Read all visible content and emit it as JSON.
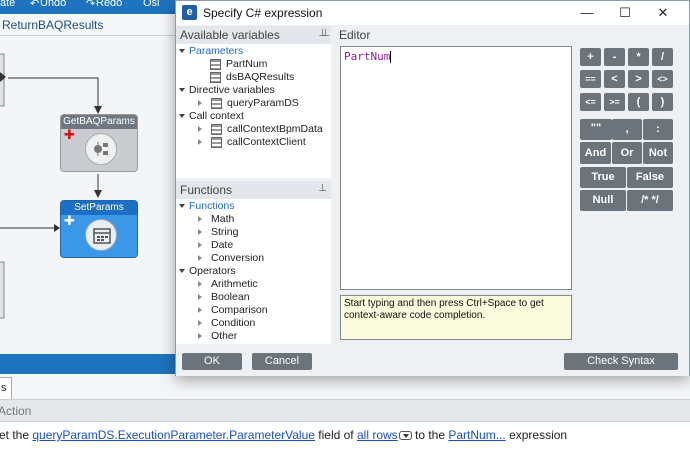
{
  "background": {
    "toolbar": {
      "items": [
        "ate",
        "Undo",
        "Redo",
        "Osi"
      ]
    },
    "tab_label": "ReturnBAQResults",
    "nodes": [
      {
        "title": "GetBAQParams",
        "style": "grey"
      },
      {
        "title": "SetParams",
        "style": "blue"
      }
    ],
    "bottom_tab_label": "s",
    "action_header": "Action",
    "action_row": {
      "prefix": "et the ",
      "field_link": "queryParamDS.ExecutionParameter.ParameterValue",
      "mid1": " field of ",
      "rows_link": "all rows",
      "mid2": " to the ",
      "value_link": "PartNum...",
      "suffix": " expression"
    }
  },
  "dialog": {
    "title": "Specify C# expression",
    "app_icon_letter": "e",
    "window_buttons": {
      "minimize": "—",
      "maximize": "☐",
      "close": "✕"
    },
    "variables_panel": {
      "header": "Available variables",
      "pin": "⊥",
      "tree": [
        {
          "label": "Parameters",
          "type": "category",
          "selected": true
        },
        {
          "label": "PartNum",
          "type": "var"
        },
        {
          "label": "dsBAQResults",
          "type": "var"
        },
        {
          "label": "Directive variables",
          "type": "category"
        },
        {
          "label": "queryParamDS",
          "type": "var-expand"
        },
        {
          "label": "Call context",
          "type": "category"
        },
        {
          "label": "callContextBpmData",
          "type": "var-expand"
        },
        {
          "label": "callContextClient",
          "type": "var-expand"
        }
      ]
    },
    "functions_panel": {
      "header": "Functions",
      "pin": "⊥",
      "tree": [
        {
          "label": "Functions",
          "type": "category",
          "selected": true
        },
        {
          "label": "Math",
          "type": "item"
        },
        {
          "label": "String",
          "type": "item"
        },
        {
          "label": "Date",
          "type": "item"
        },
        {
          "label": "Conversion",
          "type": "item"
        },
        {
          "label": "Operators",
          "type": "category"
        },
        {
          "label": "Arithmetic",
          "type": "item"
        },
        {
          "label": "Boolean",
          "type": "item"
        },
        {
          "label": "Comparison",
          "type": "item"
        },
        {
          "label": "Condition",
          "type": "item"
        },
        {
          "label": "Other",
          "type": "item"
        }
      ]
    },
    "editor": {
      "header": "Editor",
      "pin": "⊥",
      "content": "PartNum",
      "hint": "Start typing and then press Ctrl+Space to get context-aware code completion."
    },
    "keypad": {
      "symbols": [
        "+",
        "-",
        "*",
        "/",
        "==",
        "<",
        ">",
        "<>",
        "<=",
        ">=",
        "(",
        ")",
        "\"\"",
        ",",
        ":"
      ],
      "wide": [
        "And",
        "Or",
        "Not",
        "True",
        "False",
        "Null",
        "/* */"
      ]
    },
    "buttons": {
      "ok": "OK",
      "cancel": "Cancel",
      "check_syntax": "Check Syntax"
    }
  }
}
